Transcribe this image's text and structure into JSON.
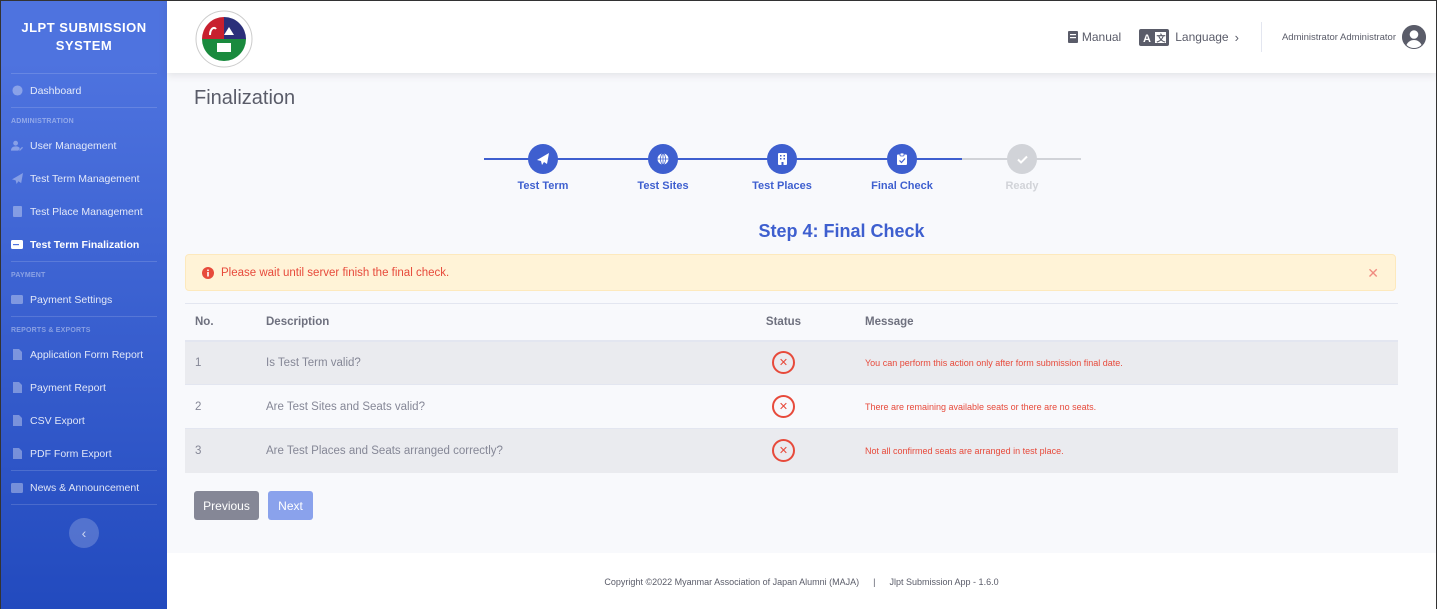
{
  "sidebar": {
    "brand": "JLPT SUBMISSION SYSTEM",
    "dashboard": "Dashboard",
    "sections": {
      "administration": "ADMINISTRATION",
      "payment": "PAYMENT",
      "reports": "REPORTS & EXPORTS"
    },
    "admin_items": [
      {
        "label": "User Management",
        "icon": "user-edit-icon"
      },
      {
        "label": "Test Term Management",
        "icon": "paper-plane-icon"
      },
      {
        "label": "Test Place Management",
        "icon": "building-icon"
      },
      {
        "label": "Test Term Finalization",
        "icon": "id-card-icon",
        "active": true
      }
    ],
    "payment_items": [
      {
        "label": "Payment Settings",
        "icon": "credit-card-icon"
      }
    ],
    "report_items": [
      {
        "label": "Application Form Report",
        "icon": "file-icon"
      },
      {
        "label": "Payment Report",
        "icon": "file-invoice-icon"
      },
      {
        "label": "CSV Export",
        "icon": "file-csv-icon"
      },
      {
        "label": "PDF Form Export",
        "icon": "file-pdf-icon"
      }
    ],
    "news": "News & Announcement",
    "toggle": "‹"
  },
  "topbar": {
    "manual": "Manual",
    "language": "Language",
    "user": "Administrator Administrator"
  },
  "page": {
    "title": "Finalization",
    "steps": [
      {
        "label": "Test Term",
        "icon": "paper-plane-icon",
        "done": true
      },
      {
        "label": "Test Sites",
        "icon": "globe-icon",
        "done": true
      },
      {
        "label": "Test Places",
        "icon": "building-icon",
        "done": true
      },
      {
        "label": "Final Check",
        "icon": "clipboard-check-icon",
        "done": true
      },
      {
        "label": "Ready",
        "icon": "check-icon",
        "done": false
      }
    ],
    "step_heading": "Step 4: Final Check",
    "alert": "Please wait until server finish the final check.",
    "table": {
      "headers": [
        "No.",
        "Description",
        "Status",
        "Message"
      ],
      "rows": [
        {
          "no": "1",
          "description": "Is Test Term valid?",
          "status": "failed",
          "message": "You can perform this action only after form submission final date."
        },
        {
          "no": "2",
          "description": "Are Test Sites and Seats valid?",
          "status": "failed",
          "message": "There are remaining available seats or there are no seats."
        },
        {
          "no": "3",
          "description": "Are Test Places and Seats arranged correctly?",
          "status": "failed",
          "message": "Not all confirmed seats are arranged in test place."
        }
      ]
    },
    "previous": "Previous",
    "next": "Next"
  },
  "footer": {
    "copyright": "Copyright ©2022 Myanmar Association of Japan Alumni (MAJA)",
    "separator": "|",
    "app": "Jlpt Submission App - 1.6.0"
  },
  "colors": {
    "primary": "#3e5fcf",
    "danger": "#e74a3b",
    "alert_bg": "#fff3d7"
  }
}
